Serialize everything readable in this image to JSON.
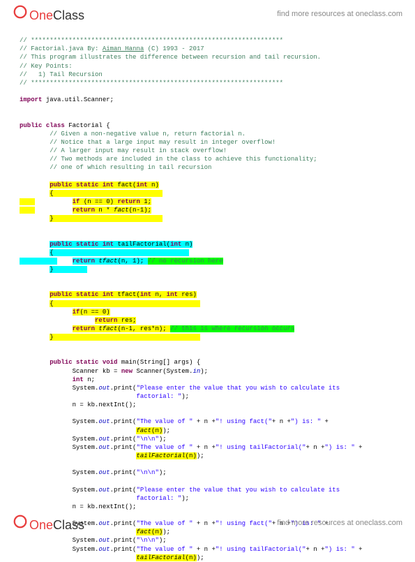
{
  "brand": {
    "one": "One",
    "class": "Class"
  },
  "headerLink": "find more resources at oneclass.com",
  "footerLink": "find more resources at oneclass.com",
  "c": {
    "hr1": "// *******************************************************************",
    "l2a": "// Factorial.java By: ",
    "l2b": "Aiman Hanna",
    "l2c": " (C) 1993 - 2017",
    "l3": "// This program illustrates the difference between recursion and tail recursion.",
    "l4": "// Key Points:",
    "l5": "//   1) Tail Recursion",
    "hr2": "// *******************************************************************",
    "imp": "import",
    "impPkg": " java.util.Scanner;",
    "pub": "public",
    "cls": "class",
    "clsName": " Factorial {",
    "cc1": "// Given a non-negative value n, return factorial n.",
    "cc2": "// Notice that a large input may result in integer overflow!",
    "cc3": "// A larger input may result in stack overflow!",
    "cc4": "// Two methods are included in the class to achieve this functionality;",
    "cc5": "// one of which resulting in tail recursion",
    "static": "static",
    "int": "int",
    "void": "void",
    "new": "new",
    "ret": "return",
    "if": "if",
    "factSig": " fact(",
    "factParam": " n)",
    "factIf": "(n == 0) ",
    "factRet1": " 1;",
    "factRet2a": " n * ",
    "factRet2b": "fact",
    "factRet2c": "(n-1);",
    "tailSig": " tailFactorial(",
    "tailParam": " n)",
    "tailBody1": "tfact",
    "tailBody2": "(n, 1); ",
    "tailComment": "// no recursion here",
    "tfactSig": " tfact(",
    "tfactP1": " n, ",
    "tfactP2": " res)",
    "tfactIf": "(n == 0)",
    "tfactRet1": " res;",
    "tfactRet2a": "tfact",
    "tfactRet2b": "(n-1, res*n); ",
    "tfactComment": "// this is where recursion occurs",
    "mainSig": " main(String[] args) {",
    "mainL1a": "Scanner kb = ",
    "mainL1b": " Scanner(System.",
    "mainIn": "in",
    "mainL1c": ");",
    "mainL2": " n;",
    "sysout": "System.",
    "out": "out",
    "print": ".print(",
    "str1": "\"Please enter the value that you wish to calculate its ",
    "str1b": "factorial: \"",
    "closeP": ");",
    "mainL4": "n = kb.nextInt();",
    "str2a": "\"The value of \"",
    "plus": " + n +",
    "str2b": "\"! using fact(\"",
    "plusn": "+ n +",
    "str2c": "\") is: \"",
    "plus2": " + ",
    "factCall": "fact",
    "callN": "(n)",
    "nl": "\"\\n\\n\"",
    "str3b": "\"! using tailFactorial(\"",
    "tailCall": "tailFactorial"
  }
}
